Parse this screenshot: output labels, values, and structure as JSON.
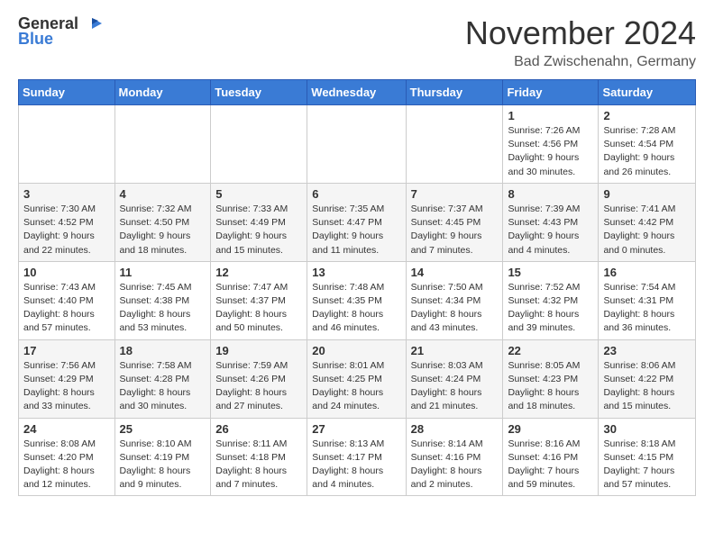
{
  "logo": {
    "general": "General",
    "blue": "Blue"
  },
  "title": "November 2024",
  "location": "Bad Zwischenahn, Germany",
  "headers": [
    "Sunday",
    "Monday",
    "Tuesday",
    "Wednesday",
    "Thursday",
    "Friday",
    "Saturday"
  ],
  "weeks": [
    [
      {
        "day": "",
        "info": ""
      },
      {
        "day": "",
        "info": ""
      },
      {
        "day": "",
        "info": ""
      },
      {
        "day": "",
        "info": ""
      },
      {
        "day": "",
        "info": ""
      },
      {
        "day": "1",
        "info": "Sunrise: 7:26 AM\nSunset: 4:56 PM\nDaylight: 9 hours and 30 minutes."
      },
      {
        "day": "2",
        "info": "Sunrise: 7:28 AM\nSunset: 4:54 PM\nDaylight: 9 hours and 26 minutes."
      }
    ],
    [
      {
        "day": "3",
        "info": "Sunrise: 7:30 AM\nSunset: 4:52 PM\nDaylight: 9 hours and 22 minutes."
      },
      {
        "day": "4",
        "info": "Sunrise: 7:32 AM\nSunset: 4:50 PM\nDaylight: 9 hours and 18 minutes."
      },
      {
        "day": "5",
        "info": "Sunrise: 7:33 AM\nSunset: 4:49 PM\nDaylight: 9 hours and 15 minutes."
      },
      {
        "day": "6",
        "info": "Sunrise: 7:35 AM\nSunset: 4:47 PM\nDaylight: 9 hours and 11 minutes."
      },
      {
        "day": "7",
        "info": "Sunrise: 7:37 AM\nSunset: 4:45 PM\nDaylight: 9 hours and 7 minutes."
      },
      {
        "day": "8",
        "info": "Sunrise: 7:39 AM\nSunset: 4:43 PM\nDaylight: 9 hours and 4 minutes."
      },
      {
        "day": "9",
        "info": "Sunrise: 7:41 AM\nSunset: 4:42 PM\nDaylight: 9 hours and 0 minutes."
      }
    ],
    [
      {
        "day": "10",
        "info": "Sunrise: 7:43 AM\nSunset: 4:40 PM\nDaylight: 8 hours and 57 minutes."
      },
      {
        "day": "11",
        "info": "Sunrise: 7:45 AM\nSunset: 4:38 PM\nDaylight: 8 hours and 53 minutes."
      },
      {
        "day": "12",
        "info": "Sunrise: 7:47 AM\nSunset: 4:37 PM\nDaylight: 8 hours and 50 minutes."
      },
      {
        "day": "13",
        "info": "Sunrise: 7:48 AM\nSunset: 4:35 PM\nDaylight: 8 hours and 46 minutes."
      },
      {
        "day": "14",
        "info": "Sunrise: 7:50 AM\nSunset: 4:34 PM\nDaylight: 8 hours and 43 minutes."
      },
      {
        "day": "15",
        "info": "Sunrise: 7:52 AM\nSunset: 4:32 PM\nDaylight: 8 hours and 39 minutes."
      },
      {
        "day": "16",
        "info": "Sunrise: 7:54 AM\nSunset: 4:31 PM\nDaylight: 8 hours and 36 minutes."
      }
    ],
    [
      {
        "day": "17",
        "info": "Sunrise: 7:56 AM\nSunset: 4:29 PM\nDaylight: 8 hours and 33 minutes."
      },
      {
        "day": "18",
        "info": "Sunrise: 7:58 AM\nSunset: 4:28 PM\nDaylight: 8 hours and 30 minutes."
      },
      {
        "day": "19",
        "info": "Sunrise: 7:59 AM\nSunset: 4:26 PM\nDaylight: 8 hours and 27 minutes."
      },
      {
        "day": "20",
        "info": "Sunrise: 8:01 AM\nSunset: 4:25 PM\nDaylight: 8 hours and 24 minutes."
      },
      {
        "day": "21",
        "info": "Sunrise: 8:03 AM\nSunset: 4:24 PM\nDaylight: 8 hours and 21 minutes."
      },
      {
        "day": "22",
        "info": "Sunrise: 8:05 AM\nSunset: 4:23 PM\nDaylight: 8 hours and 18 minutes."
      },
      {
        "day": "23",
        "info": "Sunrise: 8:06 AM\nSunset: 4:22 PM\nDaylight: 8 hours and 15 minutes."
      }
    ],
    [
      {
        "day": "24",
        "info": "Sunrise: 8:08 AM\nSunset: 4:20 PM\nDaylight: 8 hours and 12 minutes."
      },
      {
        "day": "25",
        "info": "Sunrise: 8:10 AM\nSunset: 4:19 PM\nDaylight: 8 hours and 9 minutes."
      },
      {
        "day": "26",
        "info": "Sunrise: 8:11 AM\nSunset: 4:18 PM\nDaylight: 8 hours and 7 minutes."
      },
      {
        "day": "27",
        "info": "Sunrise: 8:13 AM\nSunset: 4:17 PM\nDaylight: 8 hours and 4 minutes."
      },
      {
        "day": "28",
        "info": "Sunrise: 8:14 AM\nSunset: 4:16 PM\nDaylight: 8 hours and 2 minutes."
      },
      {
        "day": "29",
        "info": "Sunrise: 8:16 AM\nSunset: 4:16 PM\nDaylight: 7 hours and 59 minutes."
      },
      {
        "day": "30",
        "info": "Sunrise: 8:18 AM\nSunset: 4:15 PM\nDaylight: 7 hours and 57 minutes."
      }
    ]
  ]
}
